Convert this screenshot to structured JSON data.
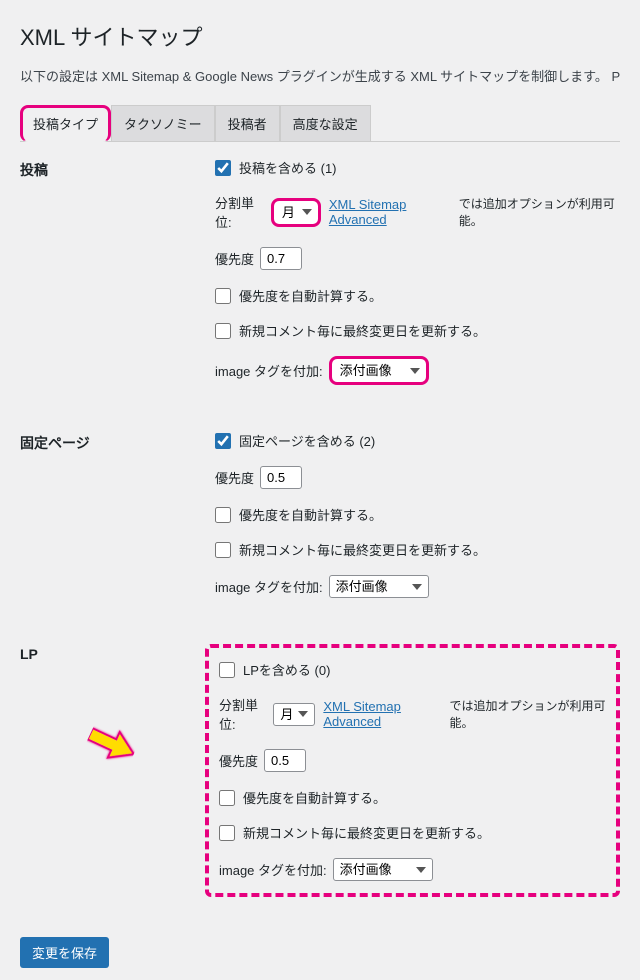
{
  "page_title": "XML サイトマップ",
  "description": "以下の設定は XML Sitemap & Google News プラグインが生成する XML サイトマップを制御します。 Ping のオプションは",
  "tabs": {
    "post_type": "投稿タイプ",
    "taxonomy": "タクソノミー",
    "author": "投稿者",
    "advanced": "高度な設定"
  },
  "labels": {
    "posts": "投稿",
    "pages": "固定ページ",
    "lp": "LP",
    "include_posts": "投稿を含める (1)",
    "include_pages": "固定ページを含める (2)",
    "include_lp": "LPを含める (0)",
    "split_by": "分割単位:",
    "priority": "優先度",
    "auto_priority": "優先度を自動計算する。",
    "update_on_comment": "新規コメント毎に最終変更日を更新する。",
    "image_tags": "image タグを付加:",
    "link_text": "XML Sitemap Advanced",
    "link_note": "では追加オプションが利用可能。"
  },
  "options": {
    "split_month": "月",
    "attach_image": "添付画像"
  },
  "values": {
    "posts_priority": "0.7",
    "pages_priority": "0.5",
    "lp_priority": "0.5"
  },
  "save_button": "変更を保存"
}
